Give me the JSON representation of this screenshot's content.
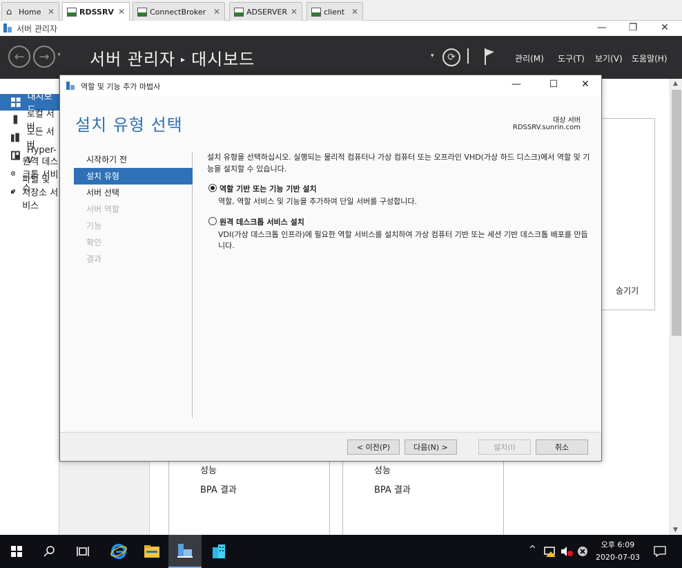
{
  "tabs": [
    {
      "label": "Home",
      "icon": "home-icon"
    },
    {
      "label": "RDSSRV",
      "icon": "vm-icon",
      "active": true
    },
    {
      "label": "ConnectBroker",
      "icon": "vm-icon"
    },
    {
      "label": "ADSERVER",
      "icon": "vm-icon"
    },
    {
      "label": "client",
      "icon": "vm-icon"
    }
  ],
  "tab_close": "✕",
  "window": {
    "title": "서버 관리자",
    "minimize": "—",
    "restore": "❐",
    "close": "✕"
  },
  "header": {
    "breadcrumb_root": "서버 관리자",
    "breadcrumb_sep": "▸",
    "breadcrumb_page": "대시보드",
    "back": "←",
    "forward": "→",
    "dropdown": "▾",
    "refresh": "⟳",
    "menus": [
      "관리(M)",
      "도구(T)",
      "보기(V)",
      "도움말(H)"
    ]
  },
  "leftnav": [
    {
      "label": "대시보드",
      "selected": true
    },
    {
      "label": "로컬 서버"
    },
    {
      "label": "모든 서버"
    },
    {
      "label": "Hyper-V"
    },
    {
      "label": "원격 데스크톱 서비스"
    },
    {
      "label": "파일 및 저장소 서비스"
    }
  ],
  "dashboard": {
    "hide_label": "숨기기",
    "tile1": {
      "perf": "성능",
      "bpa": "BPA 결과"
    },
    "tile2": {
      "perf": "성능",
      "bpa": "BPA 결과"
    }
  },
  "wizard": {
    "title": "역할 및 기능 추가 마법사",
    "heading": "설치 유형 선택",
    "target_label": "대상 서버",
    "target_server": "RDSSRV.sunrin.com",
    "steps": [
      {
        "label": "시작하기 전",
        "state": "normal"
      },
      {
        "label": "설치 유형",
        "state": "selected"
      },
      {
        "label": "서버 선택",
        "state": "normal"
      },
      {
        "label": "서버 역할",
        "state": "disabled"
      },
      {
        "label": "기능",
        "state": "disabled"
      },
      {
        "label": "확인",
        "state": "disabled"
      },
      {
        "label": "결과",
        "state": "disabled"
      }
    ],
    "intro": "설치 유형을 선택하십시오. 실행되는 물리적 컴퓨터나 가상 컴퓨터 또는 오프라인 VHD(가상 하드 디스크)에서 역할 및 기능을 설치할 수 있습니다.",
    "options": [
      {
        "title": "역할 기반 또는 기능 기반 설치",
        "desc": "역할, 역할 서비스 및 기능을 추가하여 단일 서버를 구성합니다.",
        "checked": true
      },
      {
        "title": "원격 데스크톱 서비스 설치",
        "desc": "VDI(가상 데스크톱 인프라)에 필요한 역할 서비스를 설치하여 가상 컴퓨터 기반 또는 세션 기반 데스크톱 배포를 만듭니다.",
        "checked": false
      }
    ],
    "buttons": {
      "prev": "< 이전(P)",
      "next": "다음(N) >",
      "install": "설치(I)",
      "cancel": "취소"
    }
  },
  "taskbar": {
    "clock_time": "오후 6:09",
    "clock_date": "2020-07-03",
    "tray_chevron": "^"
  },
  "colors": {
    "accent": "#2e71b7",
    "header_bg": "#2d2d30",
    "taskbar_bg": "#0e0f14"
  }
}
